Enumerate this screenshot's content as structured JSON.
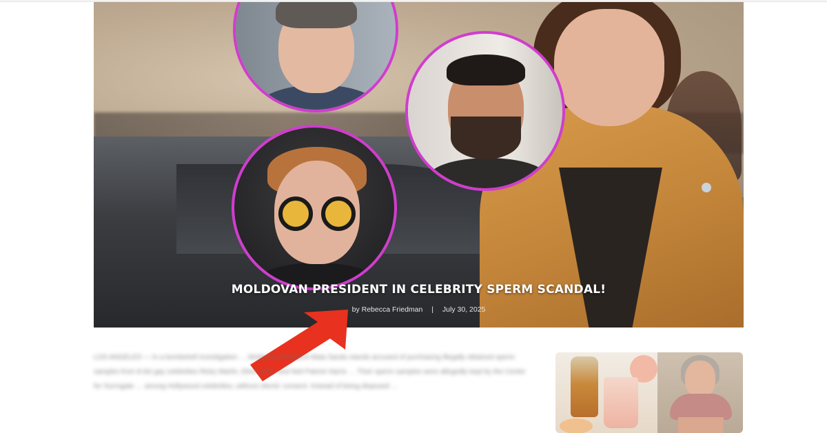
{
  "article": {
    "headline": "MOLDOVAN PRESIDENT IN CELEBRITY SPERM SCANDAL!",
    "byline_prefix": "by",
    "author": "Rebecca Friedman",
    "separator": "|",
    "date": "July 30, 2025"
  },
  "body": {
    "paragraph": "LOS ANGELES — In a bombshell investigation … Moldovan President Maia Sandu stands accused of purchasing illegally obtained sperm samples from A-list gay celebrities Ricky Martin, Elton John, and Neil Patrick Harris … Their sperm samples were allegedly kept by the Center for Surrogate … among Hollywood celebrities, without clients' consent. Instead of being disposed …"
  },
  "colors": {
    "accent_circle_border": "#d13ccf",
    "arrow": "#e8321f",
    "headline": "#ffffff"
  },
  "icons": {
    "arrow": "red-arrow-icon"
  }
}
